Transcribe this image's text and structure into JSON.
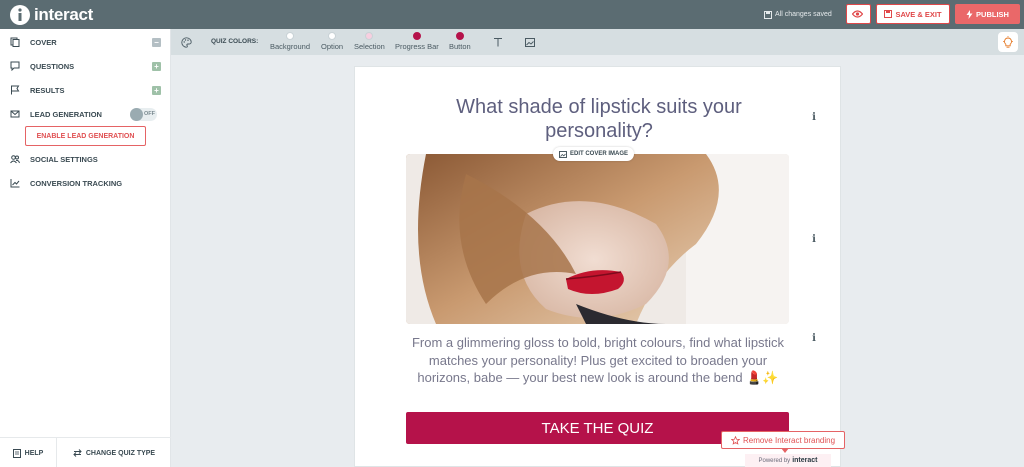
{
  "header": {
    "brand": "interact",
    "saved_status": "All changes saved",
    "save_exit_label": "SAVE & EXIT",
    "publish_label": "PUBLISH"
  },
  "sidebar": {
    "items": [
      {
        "label": "COVER",
        "icon": "pages-icon",
        "control": "minus"
      },
      {
        "label": "QUESTIONS",
        "icon": "comment-icon",
        "control": "plus"
      },
      {
        "label": "RESULTS",
        "icon": "flag-icon",
        "control": "plus"
      },
      {
        "label": "LEAD GENERATION",
        "icon": "mail-icon",
        "control": "toggle"
      },
      {
        "label": "SOCIAL SETTINGS",
        "icon": "users-icon",
        "control": "none"
      },
      {
        "label": "CONVERSION TRACKING",
        "icon": "chart-icon",
        "control": "none"
      }
    ],
    "toggle_state": "OFF",
    "enable_lead_label": "ENABLE LEAD GENERATION",
    "help_label": "HELP",
    "change_quiz_label": "CHANGE QUIZ TYPE"
  },
  "toolbar": {
    "quiz_colors_label": "QUIZ COLORS:",
    "swatches": [
      {
        "label": "Background",
        "color": "#ffffff"
      },
      {
        "label": "Option",
        "color": "#ffffff"
      },
      {
        "label": "Selection",
        "color": "#f7cfe0"
      },
      {
        "label": "Progress Bar",
        "color": "#b5124a"
      },
      {
        "label": "Button",
        "color": "#b5124a"
      }
    ]
  },
  "cover": {
    "title": "What shade of lipstick suits your personality?",
    "edit_image_label": "EDIT COVER IMAGE",
    "description": "From a glimmering gloss to bold, bright colours, find what lipstick matches your personality! Plus get excited to broaden your horizons, babe — your best new look is around the bend 💄✨",
    "button_label": "TAKE THE QUIZ",
    "button_color": "#b5124a"
  },
  "branding": {
    "remove_label": "Remove Interact branding",
    "powered_by": "Powered by",
    "powered_brand": "interact"
  }
}
